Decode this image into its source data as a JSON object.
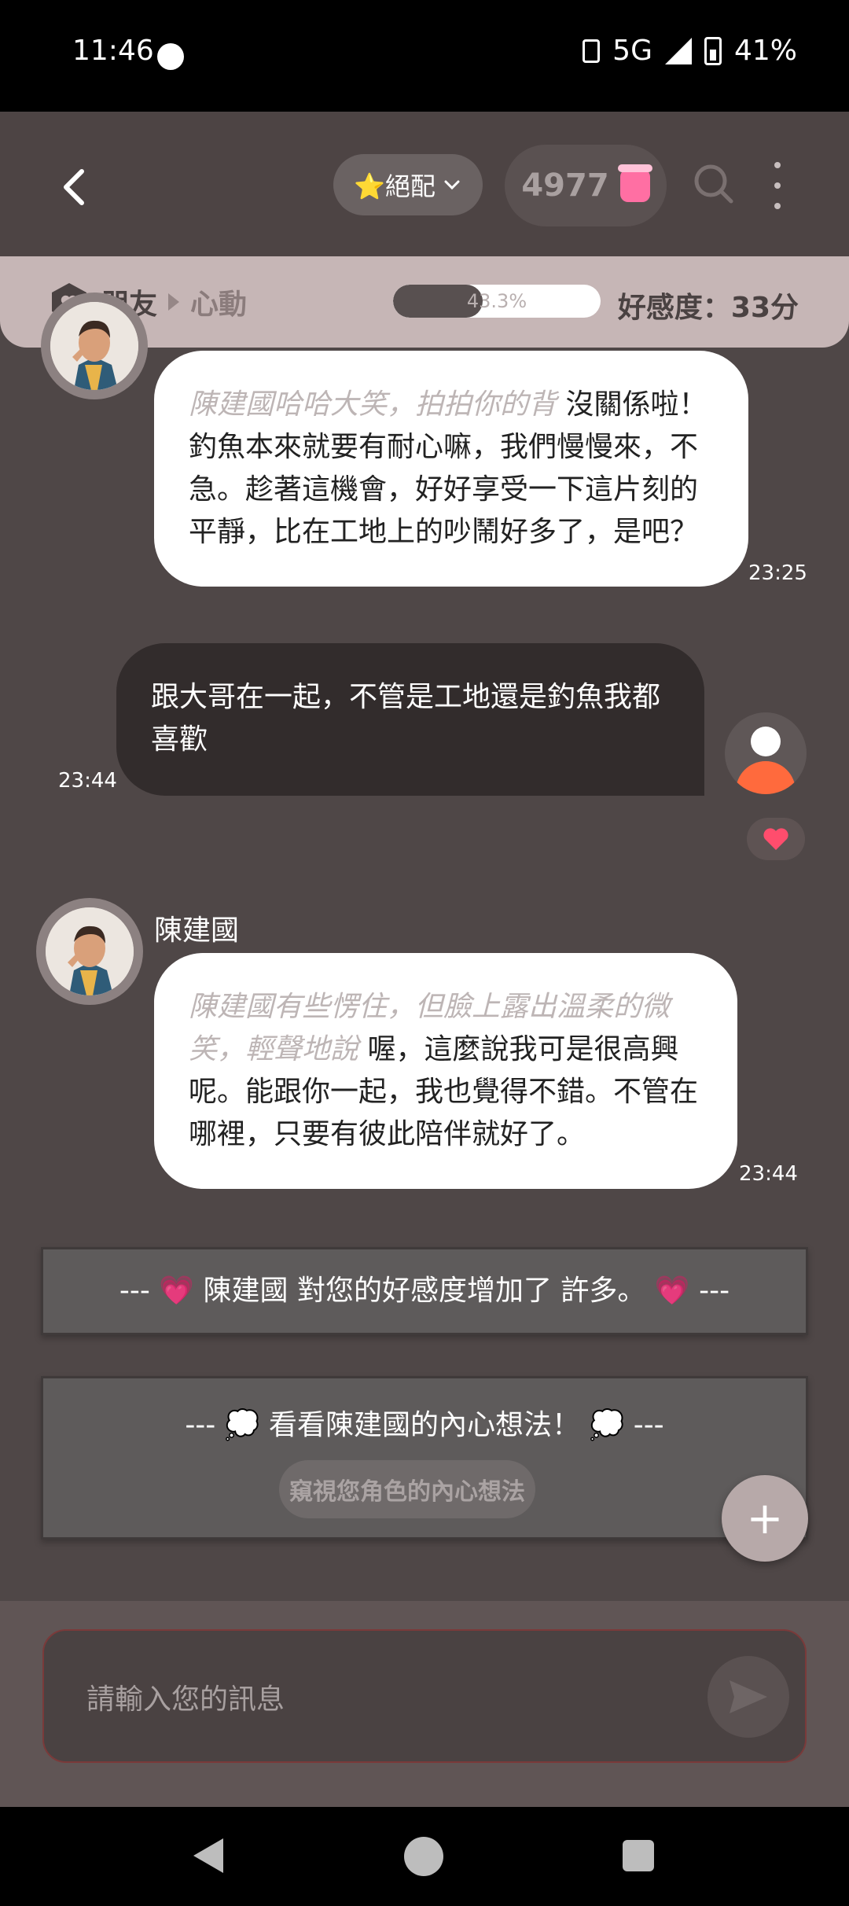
{
  "status_bar": {
    "time": "11:46",
    "network": "5G",
    "battery": "41%"
  },
  "header": {
    "match_label": "⭐絕配",
    "coins": "4977",
    "icons": {
      "back": "back-arrow-icon",
      "search": "search-icon",
      "more": "more-vertical-icon",
      "coin": "honey-jar-icon"
    }
  },
  "relation": {
    "level_from": "朋友",
    "level_to": "心動",
    "progress_text": "43.3%",
    "progress_value": 43.3,
    "favor_text": "好感度：33分"
  },
  "messages": [
    {
      "role": "ai",
      "action": "陳建國哈哈大笑，拍拍你的背",
      "text": " 沒關係啦！釣魚本來就要有耐心嘛，我們慢慢來，不急。趁著這機會，好好享受一下這片刻的平靜，比在工地上的吵鬧好多了，是吧？",
      "time": "23:25"
    },
    {
      "role": "user",
      "text": "跟大哥在一起，不管是工地還是釣魚我都喜歡",
      "time": "23:44"
    },
    {
      "role": "ai",
      "name": "陳建國",
      "action": "陳建國有些愣住，但臉上露出溫柔的微笑，輕聲地說",
      "text": " 喔，這麼說我可是很高興呢。能跟你一起，我也覺得不錯。不管在哪裡，只要有彼此陪伴就好了。",
      "time": "23:44"
    }
  ],
  "system": {
    "favor_notice": "--- 💗 陳建國 對您的好感度增加了 許多。 💗 ---",
    "thought_notice": "--- 💭 看看陳建國的內心想法！ 💭 ---",
    "peek_button": "窺視您角色的內心想法"
  },
  "input": {
    "placeholder": "請輸入您的訊息"
  },
  "colors": {
    "background": "#4f4747",
    "relation_bar": "#c6b6b6",
    "user_bubble": "#322c2c",
    "accent_pink": "#ff6fa3",
    "user_avatar": "#ff6a3d",
    "like_heart": "#ff4d6d"
  }
}
